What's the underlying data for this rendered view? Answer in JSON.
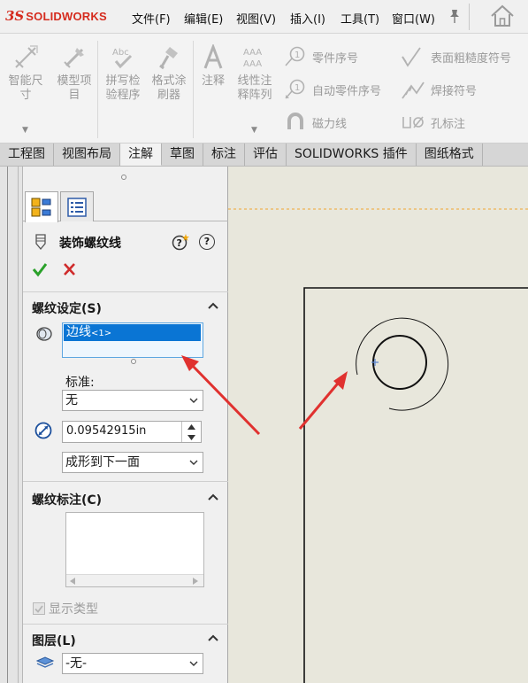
{
  "app": {
    "logo_ds": "3S",
    "logo_text": "SOLIDWORKS",
    "brand_color": "#d52b1e"
  },
  "menu": [
    {
      "label": "文件(F)"
    },
    {
      "label": "编辑(E)"
    },
    {
      "label": "视图(V)"
    },
    {
      "label": "插入(I)"
    },
    {
      "label": "工具(T)"
    },
    {
      "label": "窗口(W)"
    }
  ],
  "ribbon": {
    "smart_dim": {
      "line1": "智能尺",
      "line2": "寸"
    },
    "model_items": {
      "line1": "模型项",
      "line2": "目"
    },
    "spell_check": {
      "line1": "拼写检",
      "line2": "验程序",
      "icon_text": "Abc"
    },
    "format_painter": {
      "line1": "格式涂",
      "line2": "刷器"
    },
    "note": {
      "label": "注释"
    },
    "linear_note_pattern": {
      "line1": "线性注",
      "line2": "释阵列",
      "icon_text": "AAA"
    },
    "balloon": {
      "label": "零件序号"
    },
    "auto_balloon": {
      "label": "自动零件序号"
    },
    "magnetic_line": {
      "label": "磁力线"
    },
    "surface_finish": {
      "label": "表面粗糙度符号"
    },
    "weld_symbol": {
      "label": "焊接符号"
    },
    "hole_callout": {
      "label": "孔标注"
    }
  },
  "tabs": [
    {
      "label": "工程图",
      "active": false
    },
    {
      "label": "视图布局",
      "active": false
    },
    {
      "label": "注解",
      "active": true
    },
    {
      "label": "草图",
      "active": false
    },
    {
      "label": "标注",
      "active": false
    },
    {
      "label": "评估",
      "active": false
    },
    {
      "label": "SOLIDWORKS 插件",
      "active": false
    },
    {
      "label": "图纸格式",
      "active": false
    }
  ],
  "property_manager": {
    "title": "装饰螺纹线",
    "thread_settings": {
      "header": "螺纹设定(S)",
      "selected_edge": "边线",
      "selected_edge_index": "<1>",
      "standard_label": "标准:",
      "standard_value": "无",
      "diameter_value": "0.09542915in",
      "end_condition": "成形到下一面"
    },
    "thread_callout": {
      "header": "螺纹标注(C)",
      "text": ""
    },
    "show_type": {
      "label": "显示类型",
      "checked": true,
      "enabled": false
    },
    "layer": {
      "header": "图层(L)",
      "value": "-无-"
    }
  },
  "colors": {
    "selection_blue": "#0a75d4",
    "ok_green": "#2aa12a",
    "cancel_red": "#cf2b2b",
    "arrow_red": "#e0312f",
    "canvas_bg": "#e8e7dc",
    "sheet_border_orange": "#f0a431"
  }
}
